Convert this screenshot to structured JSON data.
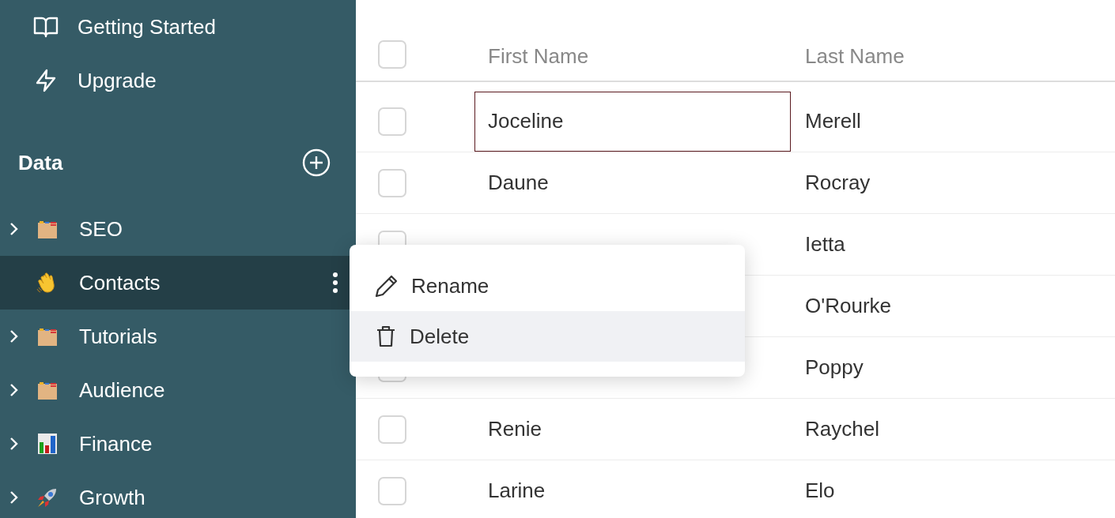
{
  "sidebar": {
    "nav": [
      {
        "label": "Getting Started",
        "kind": "book"
      },
      {
        "label": "Upgrade",
        "kind": "bolt"
      }
    ],
    "section": {
      "title": "Data"
    },
    "tree": [
      {
        "label": "SEO",
        "kind": "folder",
        "expandable": true,
        "selected": false
      },
      {
        "label": "Contacts",
        "kind": "hand",
        "expandable": false,
        "selected": true
      },
      {
        "label": "Tutorials",
        "kind": "folder",
        "expandable": true,
        "selected": false
      },
      {
        "label": "Audience",
        "kind": "folder",
        "expandable": true,
        "selected": false
      },
      {
        "label": "Finance",
        "kind": "chart",
        "expandable": true,
        "selected": false
      },
      {
        "label": "Growth",
        "kind": "rocket",
        "expandable": true,
        "selected": false
      }
    ]
  },
  "table": {
    "all_checked": false,
    "columns": [
      "First Name",
      "Last Name"
    ],
    "rows": [
      {
        "first_name": "Joceline",
        "last_name": "Merell",
        "checked": false,
        "focused": true
      },
      {
        "first_name": "Daune",
        "last_name": "Rocray",
        "checked": false,
        "focused": false
      },
      {
        "last_name": "Ietta",
        "checked": false,
        "focused": false
      },
      {
        "last_name": "O'Rourke",
        "focused": false
      },
      {
        "last_name": "Poppy",
        "checked": false,
        "focused": false
      },
      {
        "first_name": "Renie",
        "last_name": "Raychel",
        "checked": false,
        "focused": false
      },
      {
        "first_name": "Larine",
        "last_name": "Elo",
        "checked": false,
        "focused": false
      }
    ]
  },
  "context_menu": {
    "items": [
      {
        "label": "Rename",
        "kind": "pencil",
        "selected": false
      },
      {
        "label": "Delete",
        "kind": "trash",
        "selected": true
      }
    ]
  }
}
